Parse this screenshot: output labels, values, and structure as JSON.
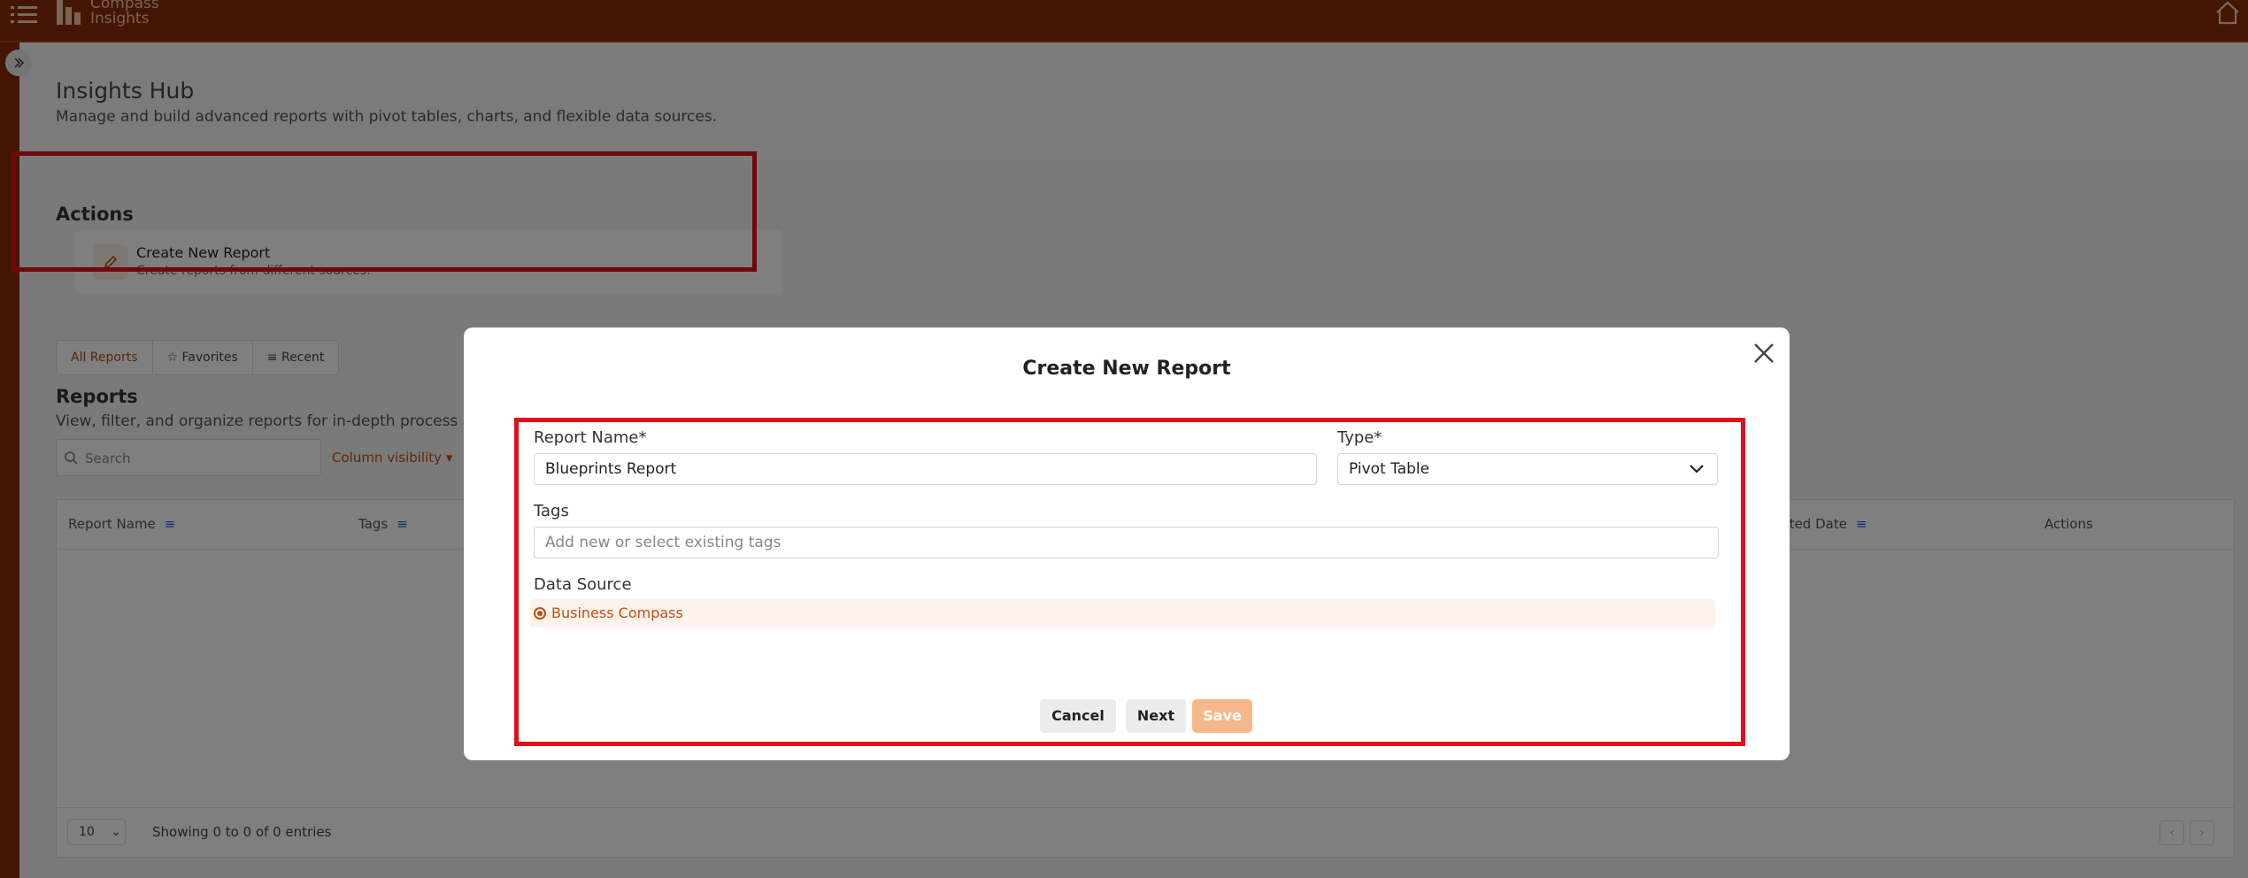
{
  "app": {
    "logo_line1": "Compass",
    "logo_line2": "Insights"
  },
  "hub": {
    "title": "Insights Hub",
    "subtitle": "Manage and build advanced reports with pivot tables, charts, and flexible data sources."
  },
  "actions": {
    "title": "Actions",
    "create_title": "Create New Report",
    "create_desc": "Create reports from different sources."
  },
  "tabs": [
    {
      "label": "All Reports"
    },
    {
      "label": "Favorites"
    },
    {
      "label": "Recent"
    }
  ],
  "reports": {
    "title": "Reports",
    "subtitle": "View, filter, and organize reports for in-depth process and",
    "search_placeholder": "Search",
    "column_visibility": "Column visibility",
    "columns": [
      "Report Name",
      "Tags",
      "dited Date",
      "Actions"
    ],
    "page_size": "10",
    "showing": "Showing 0 to 0 of 0 entries"
  },
  "modal": {
    "title": "Create New Report",
    "report_name_label": "Report Name*",
    "report_name_value": "Blueprints Report",
    "type_label": "Type*",
    "type_value": "Pivot Table",
    "tags_label": "Tags",
    "tags_placeholder": "Add new or select existing tags",
    "data_source_label": "Data Source",
    "data_source_option": "Business Compass",
    "cancel": "Cancel",
    "next": "Next",
    "save": "Save"
  },
  "colors": {
    "brand": "#8a2a08",
    "accent": "#c05010",
    "highlight": "#e0101a",
    "save_disabled": "#f6b88a"
  }
}
